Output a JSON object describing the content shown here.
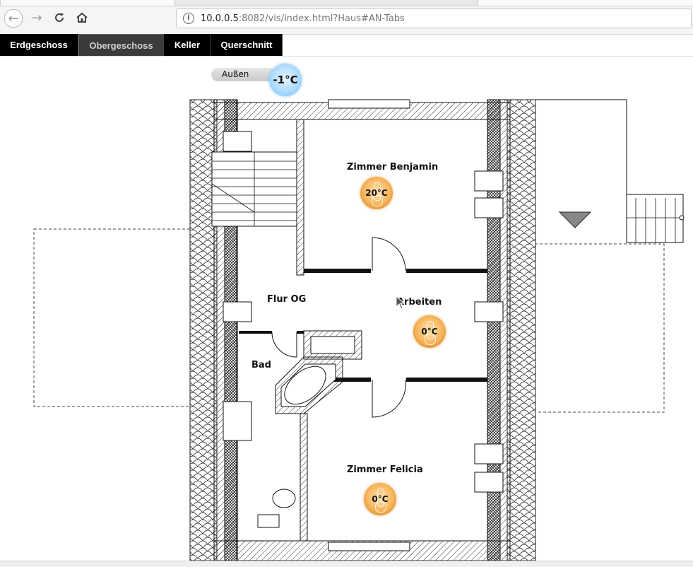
{
  "browser": {
    "url_host": "10.0.0.5",
    "url_rest": ":8082/vis/index.html?Haus#AN-Tabs"
  },
  "tabs": [
    {
      "label": "Erdgeschoss",
      "active": false
    },
    {
      "label": "Obergeschoss",
      "active": true
    },
    {
      "label": "Keller",
      "active": false
    },
    {
      "label": "Querschnitt",
      "active": false
    }
  ],
  "outside": {
    "label": "Außen",
    "temperature": "-1°C"
  },
  "rooms": {
    "benjamin": {
      "label": "Zimmer Benjamin",
      "temperature": "20°C"
    },
    "flur": {
      "label": "Flur OG"
    },
    "arbeiten": {
      "label": "Arbeiten",
      "temperature": "0°C"
    },
    "bad": {
      "label": "Bad"
    },
    "felicia": {
      "label": "Zimmer Felicia",
      "temperature": "0°C"
    }
  },
  "colors": {
    "tab_bg": "#000000",
    "tab_active_bg": "#3b3b3b",
    "warm_badge": "#f7b45a",
    "cold_badge": "#a8d9ff"
  },
  "icons": [
    "back-arrow-icon",
    "forward-arrow-icon",
    "reload-icon",
    "home-icon",
    "info-icon",
    "thermometer-icon",
    "triangle-marker-icon",
    "mouse-cursor-icon"
  ]
}
